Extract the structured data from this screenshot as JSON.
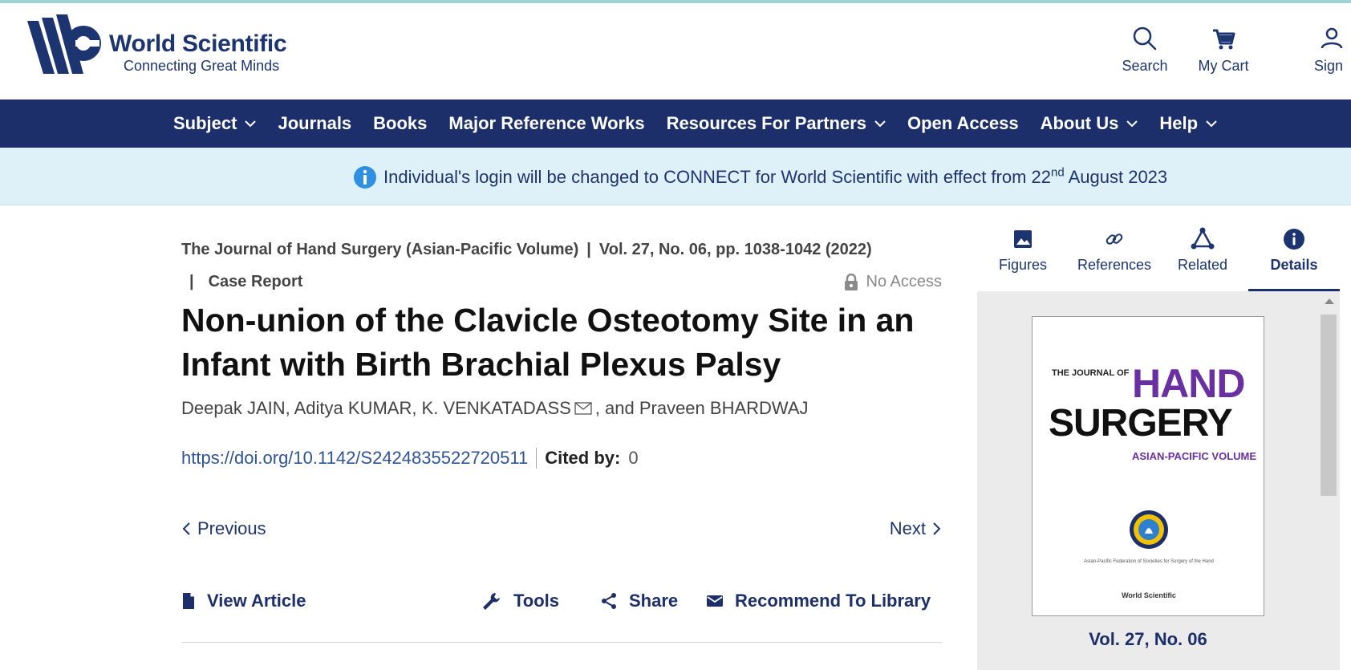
{
  "header": {
    "logo_title": "World Scientific",
    "logo_tagline": "Connecting Great Minds",
    "actions": [
      {
        "label": "Search",
        "icon": "search-icon"
      },
      {
        "label": "My Cart",
        "icon": "cart-icon"
      },
      {
        "label": "Sign",
        "icon": "user-icon"
      }
    ]
  },
  "nav": {
    "items": [
      {
        "label": "Subject",
        "has_dropdown": true
      },
      {
        "label": "Journals",
        "has_dropdown": false
      },
      {
        "label": "Books",
        "has_dropdown": false
      },
      {
        "label": "Major Reference Works",
        "has_dropdown": false
      },
      {
        "label": "Resources For Partners",
        "has_dropdown": true
      },
      {
        "label": "Open Access",
        "has_dropdown": false
      },
      {
        "label": "About Us",
        "has_dropdown": true
      },
      {
        "label": "Help",
        "has_dropdown": true
      }
    ]
  },
  "notice": {
    "text_before": "Individual's login will be changed to CONNECT for World Scientific with effect from 22",
    "superscript": "nd",
    "text_after": " August 2023"
  },
  "article": {
    "journal": "The Journal of Hand Surgery (Asian-Pacific Volume)",
    "separator": "|",
    "volume_info": "Vol. 27, No. 06, pp. 1038-1042 (2022)",
    "type": "Case Report",
    "access": "No Access",
    "title": "Non-union of the Clavicle Osteotomy Site in an Infant with Birth Brachial Plexus Palsy",
    "authors_before": "Deepak JAIN, Aditya KUMAR, K. VENKATADASS",
    "authors_after": ", and Praveen BHARDWAJ",
    "doi": "https://doi.org/10.1142/S2424835522720511",
    "cited_label": "Cited by:",
    "cited_count": "0",
    "previous": "Previous",
    "next": "Next",
    "actions": {
      "view_article": "View Article",
      "tools": "Tools",
      "share": "Share",
      "recommend": "Recommend To Library"
    }
  },
  "sidebar": {
    "tabs": [
      {
        "label": "Figures",
        "icon": "image-icon"
      },
      {
        "label": "References",
        "icon": "link-icon"
      },
      {
        "label": "Related",
        "icon": "network-icon"
      },
      {
        "label": "Details",
        "icon": "info-icon",
        "active": true
      }
    ],
    "cover": {
      "top_text": "THE JOURNAL OF",
      "hand": "HAND",
      "surgery": "SURGERY",
      "subtitle": "ASIAN-PACIFIC VOLUME",
      "federation": "Asian-Pacific Federation of Societies for Surgery of the Hand",
      "publisher": "World Scientific"
    },
    "volume_label": "Vol. 27, No. 06"
  },
  "colors": {
    "brand_navy": "#1c2f6b",
    "notice_bg": "#def0f8",
    "link_blue": "#2e5497",
    "hand_purple": "#6a2fa0"
  }
}
